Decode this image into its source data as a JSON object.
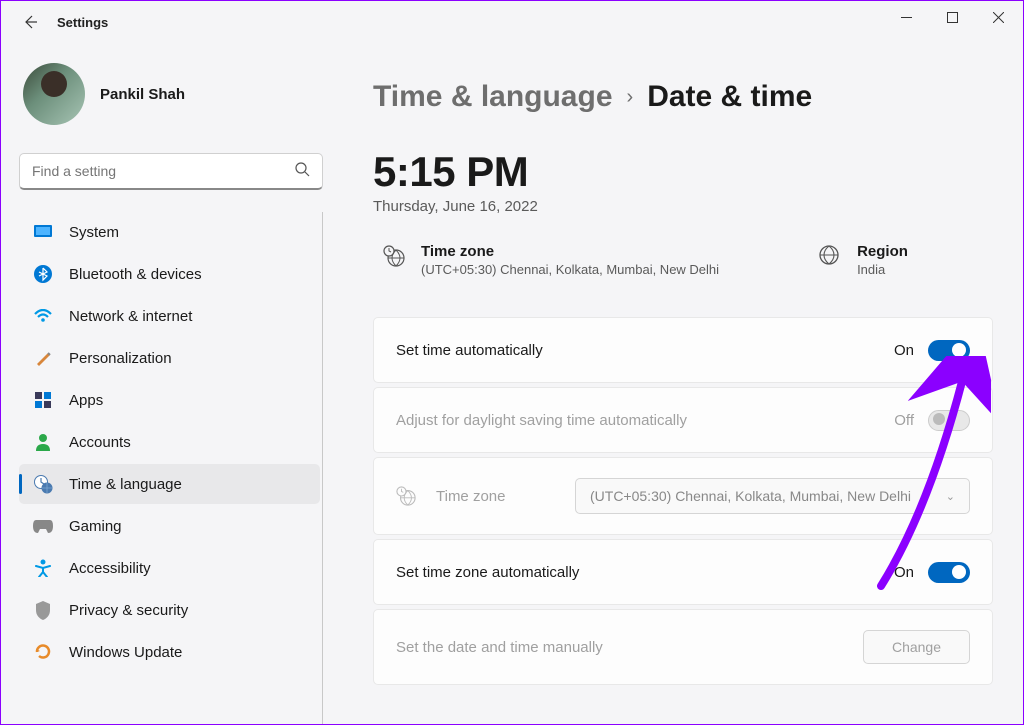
{
  "window": {
    "title": "Settings"
  },
  "user": {
    "name": "Pankil Shah"
  },
  "search": {
    "placeholder": "Find a setting"
  },
  "sidebar": {
    "items": [
      {
        "label": "System",
        "icon": "system"
      },
      {
        "label": "Bluetooth & devices",
        "icon": "bluetooth"
      },
      {
        "label": "Network & internet",
        "icon": "wifi"
      },
      {
        "label": "Personalization",
        "icon": "brush"
      },
      {
        "label": "Apps",
        "icon": "apps"
      },
      {
        "label": "Accounts",
        "icon": "person"
      },
      {
        "label": "Time & language",
        "icon": "clock-lang"
      },
      {
        "label": "Gaming",
        "icon": "gamepad"
      },
      {
        "label": "Accessibility",
        "icon": "accessibility"
      },
      {
        "label": "Privacy & security",
        "icon": "shield"
      },
      {
        "label": "Windows Update",
        "icon": "update"
      }
    ]
  },
  "breadcrumb": {
    "parent": "Time & language",
    "current": "Date & time"
  },
  "clock": {
    "time": "5:15 PM",
    "date": "Thursday, June 16, 2022"
  },
  "info": {
    "timezone": {
      "label": "Time zone",
      "value": "(UTC+05:30) Chennai, Kolkata, Mumbai, New Delhi"
    },
    "region": {
      "label": "Region",
      "value": "India"
    }
  },
  "cards": {
    "set_time_auto": {
      "label": "Set time automatically",
      "state": "On"
    },
    "dst_auto": {
      "label": "Adjust for daylight saving time automatically",
      "state": "Off"
    },
    "timezone_select": {
      "label": "Time zone",
      "value": "(UTC+05:30) Chennai, Kolkata, Mumbai, New Delhi"
    },
    "set_tz_auto": {
      "label": "Set time zone automatically",
      "state": "On"
    },
    "set_manual": {
      "label": "Set the date and time manually",
      "button": "Change"
    }
  }
}
